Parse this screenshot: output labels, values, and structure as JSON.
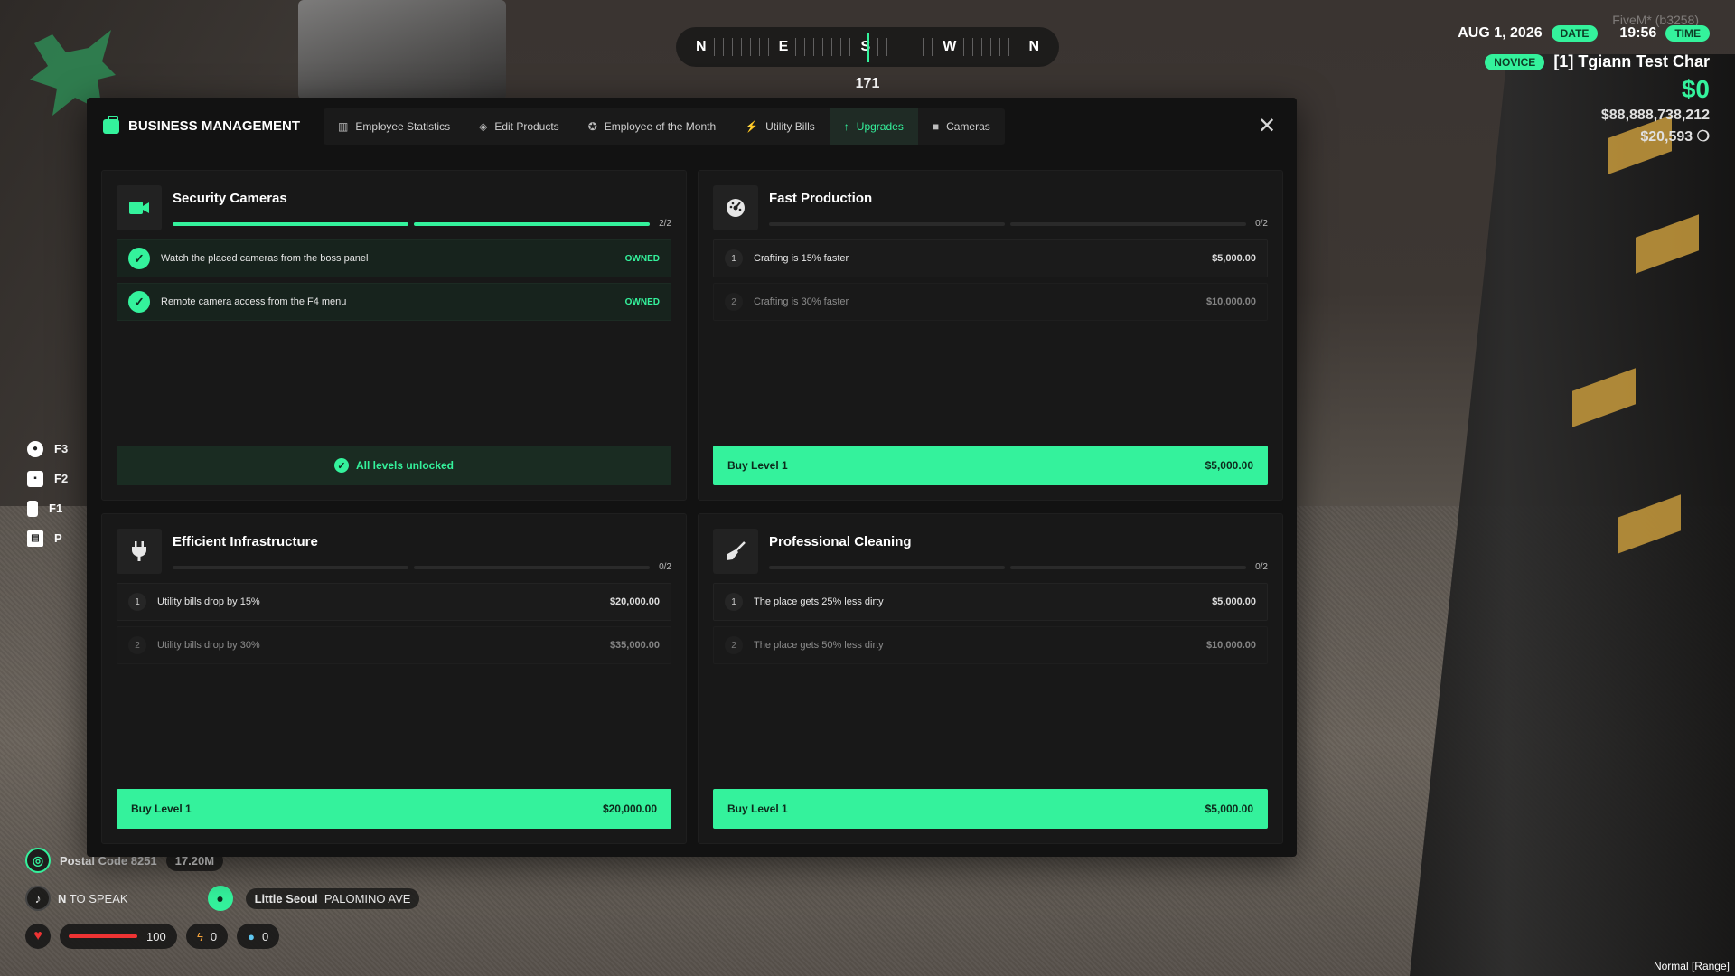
{
  "compass": {
    "dirs": [
      "N",
      "E",
      "S",
      "W",
      "N"
    ],
    "heading": "171"
  },
  "hud": {
    "version": "FiveM* (b3258)",
    "date": "AUG 1, 2026",
    "date_label": "DATE",
    "time": "19:56",
    "time_label": "TIME",
    "rank": "NOVICE",
    "character": "[1] Tgiann Test Char",
    "cash": "$0",
    "bank": "$88,888,738,212",
    "black_money": "$20,593"
  },
  "keys": [
    {
      "key": "F3",
      "icon": "circle-icon"
    },
    {
      "key": "F2",
      "icon": "bag-icon"
    },
    {
      "key": "F1",
      "icon": "phone-icon"
    },
    {
      "key": "P",
      "icon": "map-icon"
    }
  ],
  "location": {
    "postal": "Postal Code 8251",
    "distance": "17.20M",
    "voice_key": "N",
    "voice_label": "TO SPEAK",
    "zone": "Little Seoul",
    "street": "PALOMINO AVE"
  },
  "stats": {
    "health": "100",
    "stamina": "0",
    "water": "0"
  },
  "mode": "Normal [Range]",
  "panel": {
    "title": "BUSINESS MANAGEMENT",
    "tabs": [
      {
        "label": "Employee Statistics",
        "icon": "chart-icon",
        "glyph": "▥",
        "active": false
      },
      {
        "label": "Edit Products",
        "icon": "tag-icon",
        "glyph": "◈",
        "active": false
      },
      {
        "label": "Employee of the Month",
        "icon": "award-icon",
        "glyph": "✪",
        "active": false
      },
      {
        "label": "Utility Bills",
        "icon": "bolt-icon",
        "glyph": "⚡",
        "active": false
      },
      {
        "label": "Upgrades",
        "icon": "arrow-up-icon",
        "glyph": "↑",
        "active": true
      },
      {
        "label": "Cameras",
        "icon": "camera-icon",
        "glyph": "■",
        "active": false
      }
    ],
    "close": "✕"
  },
  "upgrades": [
    {
      "title": "Security Cameras",
      "icon": "video-camera-icon",
      "progress": {
        "owned": 2,
        "total": 2,
        "label": "2/2"
      },
      "levels": [
        {
          "num": "1",
          "text": "Watch the placed cameras from the boss panel",
          "status": "OWNED",
          "owned": true
        },
        {
          "num": "2",
          "text": "Remote camera access from the F4 menu",
          "status": "OWNED",
          "owned": true
        }
      ],
      "complete": true,
      "complete_label": "All levels unlocked"
    },
    {
      "title": "Fast Production",
      "icon": "speedometer-icon",
      "progress": {
        "owned": 0,
        "total": 2,
        "label": "0/2"
      },
      "levels": [
        {
          "num": "1",
          "text": "Crafting is 15% faster",
          "price": "$5,000.00",
          "owned": false,
          "dim": false
        },
        {
          "num": "2",
          "text": "Crafting is 30% faster",
          "price": "$10,000.00",
          "owned": false,
          "dim": true
        }
      ],
      "complete": false,
      "buy_label": "Buy Level 1",
      "buy_price": "$5,000.00"
    },
    {
      "title": "Efficient Infrastructure",
      "icon": "plug-icon",
      "progress": {
        "owned": 0,
        "total": 2,
        "label": "0/2"
      },
      "levels": [
        {
          "num": "1",
          "text": "Utility bills drop by 15%",
          "price": "$20,000.00",
          "owned": false,
          "dim": false
        },
        {
          "num": "2",
          "text": "Utility bills drop by 30%",
          "price": "$35,000.00",
          "owned": false,
          "dim": true
        }
      ],
      "complete": false,
      "buy_label": "Buy Level 1",
      "buy_price": "$20,000.00"
    },
    {
      "title": "Professional Cleaning",
      "icon": "broom-icon",
      "progress": {
        "owned": 0,
        "total": 2,
        "label": "0/2"
      },
      "levels": [
        {
          "num": "1",
          "text": "The place gets 25% less dirty",
          "price": "$5,000.00",
          "owned": false,
          "dim": false
        },
        {
          "num": "2",
          "text": "The place gets 50% less dirty",
          "price": "$10,000.00",
          "owned": false,
          "dim": true
        }
      ],
      "complete": false,
      "buy_label": "Buy Level 1",
      "buy_price": "$5,000.00"
    }
  ],
  "colors": {
    "accent": "#34f29c",
    "panel": "#121212",
    "card": "#181818"
  }
}
